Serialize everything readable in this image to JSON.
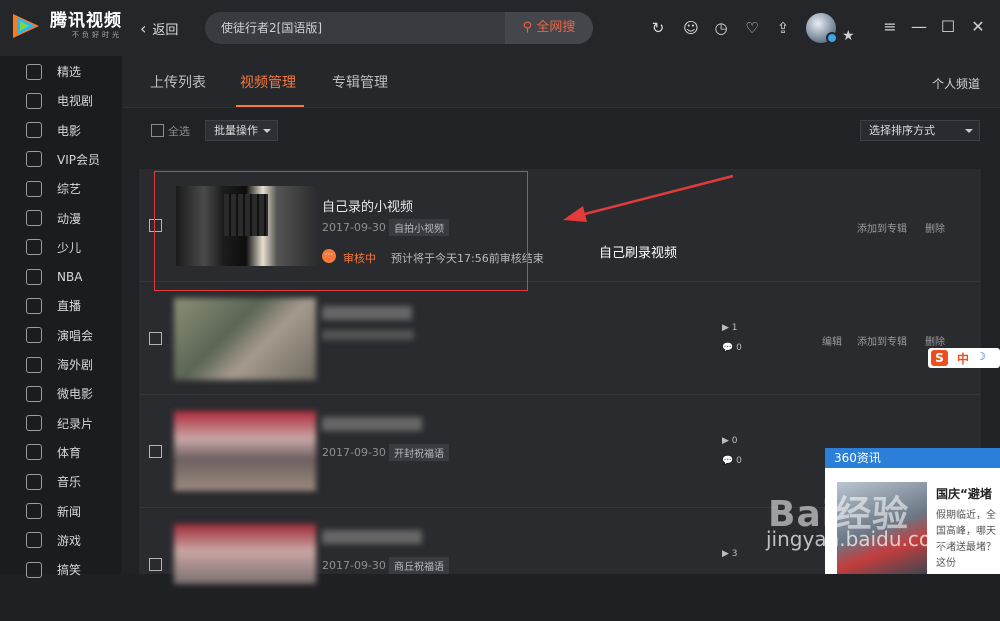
{
  "app": {
    "logo_title": "腾讯视频",
    "logo_sub": "不负好时光"
  },
  "nav": {
    "back_label": "返回"
  },
  "search": {
    "query": "使徒行者2[国语版]",
    "button_label": "全网搜"
  },
  "sidebar": {
    "items": [
      {
        "label": "精选",
        "icon": "thumbs-up-icon"
      },
      {
        "label": "电视剧",
        "icon": "tv-icon"
      },
      {
        "label": "电影",
        "icon": "film-reel-icon"
      },
      {
        "label": "VIP会员",
        "icon": "star-icon"
      },
      {
        "label": "综艺",
        "icon": "microphone-star-icon"
      },
      {
        "label": "动漫",
        "icon": "cartoon-face-icon"
      },
      {
        "label": "少儿",
        "icon": "child-face-icon"
      },
      {
        "label": "NBA",
        "icon": "nba-icon"
      },
      {
        "label": "直播",
        "icon": "microphone-icon"
      },
      {
        "label": "演唱会",
        "icon": "concert-icon"
      },
      {
        "label": "海外剧",
        "icon": "globe-icon"
      },
      {
        "label": "微电影",
        "icon": "clapper-icon"
      },
      {
        "label": "纪录片",
        "icon": "camera-icon"
      },
      {
        "label": "体育",
        "icon": "ball-icon"
      },
      {
        "label": "音乐",
        "icon": "music-note-icon"
      },
      {
        "label": "新闻",
        "icon": "newspaper-icon"
      },
      {
        "label": "游戏",
        "icon": "gamepad-icon"
      },
      {
        "label": "搞笑",
        "icon": "laugh-face-icon"
      }
    ]
  },
  "tabs": [
    {
      "label": "上传列表",
      "active": false
    },
    {
      "label": "视频管理",
      "active": true
    },
    {
      "label": "专辑管理",
      "active": false
    }
  ],
  "header": {
    "personal_channel": "个人频道"
  },
  "toolbar": {
    "select_all": "全选",
    "batch": "批量操作",
    "sort": "选择排序方式"
  },
  "rows": [
    {
      "title": "自己录的小视频",
      "date": "2017-09-30",
      "tag": "自拍小视频",
      "status": "审核中",
      "status_note": "预计将于今天17:56前审核结束",
      "actions": [
        "添加到专辑",
        "删除"
      ]
    },
    {
      "title": "",
      "date": "",
      "tag": "",
      "plays": "1",
      "comments": "0",
      "actions": [
        "编辑",
        "添加到专辑",
        "删除"
      ]
    },
    {
      "title": "",
      "date": "2017-09-30",
      "tag": "开封祝福语",
      "plays": "0",
      "comments": "0"
    },
    {
      "title": "",
      "date": "2017-09-30",
      "tag": "商丘祝福语",
      "plays": "3"
    }
  ],
  "annotation": {
    "text": "自己刷录视频"
  },
  "news_popup": {
    "header": "360资讯",
    "title": "国庆“避堵",
    "snippet": "假期临近，全国高峰，哪天不堵送最堵？这份"
  },
  "watermark": {
    "brand": "Bai经验",
    "domain": "jingyan.baidu.com"
  },
  "ime": {
    "label": "中"
  },
  "colors": {
    "accent": "#f5793e",
    "annotation_red": "#e23b3b",
    "news_blue": "#2b7fd8"
  }
}
